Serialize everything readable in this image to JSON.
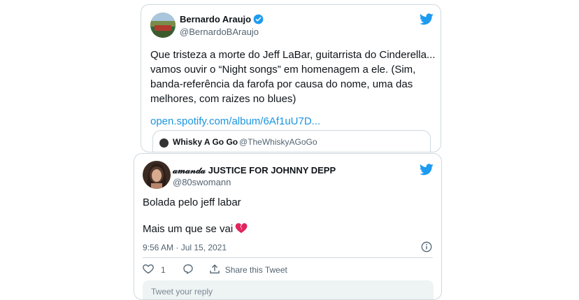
{
  "tweet1": {
    "display_name": "Bernardo Araujo",
    "handle": "@BernardoBAraujo",
    "text": "Que tristeza a morte do Jeff LaBar, guitarrista do Cinderella... vamos ouvir o “Night songs” em homenagem a ele. (Sim, banda-referência da farofa por causa do nome, uma das melhores, com raizes no blues)",
    "link": "open.spotify.com/album/6Af1uU7D...",
    "quoted": {
      "display_name": "Whisky A Go Go",
      "handle": "@TheWhiskyAGoGo"
    }
  },
  "tweet2": {
    "display_name": "𝒶𝓂𝒶𝓃𝒹𝒶 JUSTICE FOR JOHNNY DEPP",
    "handle": "@80swomann",
    "line1": "Bolada pelo jeff labar",
    "line2": "Mais um que se vai",
    "timestamp": "9:56 AM · Jul 15, 2021",
    "like_count": "1",
    "share_label": "Share this Tweet",
    "reply_placeholder": "Tweet your reply"
  },
  "colors": {
    "twitter_blue": "#1d9bf0",
    "link_blue": "#1b95e0",
    "heart_red": "#e0245e",
    "border": "#cfd9de",
    "secondary_text": "#536471"
  }
}
